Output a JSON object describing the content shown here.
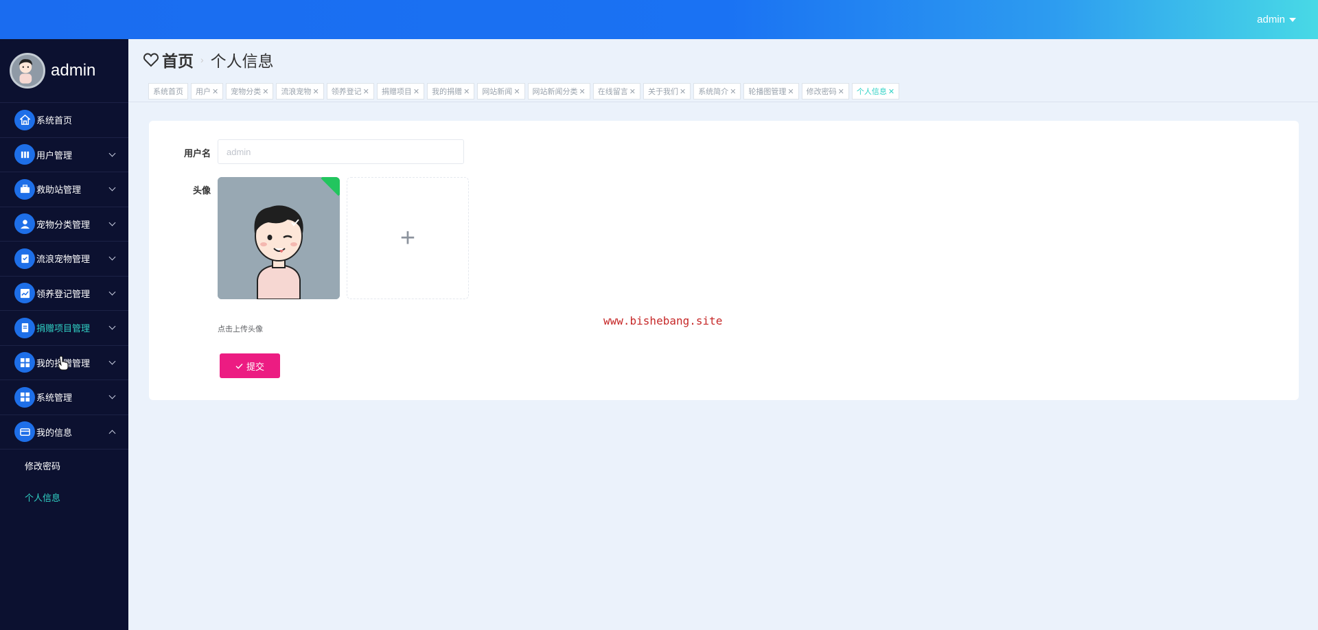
{
  "topbar": {
    "user_label": "admin"
  },
  "sidebar": {
    "profile_name": "admin",
    "items": [
      {
        "label": "系统首页",
        "icon": "home-icon"
      },
      {
        "label": "用户管理",
        "icon": "users-icon"
      },
      {
        "label": "救助站管理",
        "icon": "briefcase-icon"
      },
      {
        "label": "宠物分类管理",
        "icon": "person-icon"
      },
      {
        "label": "流浪宠物管理",
        "icon": "clipboard-icon"
      },
      {
        "label": "领养登记管理",
        "icon": "chart-icon"
      },
      {
        "label": "捐赠项目管理",
        "icon": "document-icon"
      },
      {
        "label": "我的捐赠管理",
        "icon": "grid-icon"
      },
      {
        "label": "系统管理",
        "icon": "grid-icon"
      },
      {
        "label": "我的信息",
        "icon": "card-icon"
      }
    ],
    "sub_items": [
      {
        "label": "修改密码"
      },
      {
        "label": "个人信息"
      }
    ]
  },
  "breadcrumb": {
    "home": "首页",
    "current": "个人信息"
  },
  "tags": [
    {
      "label": "系统首页",
      "closable": false
    },
    {
      "label": "用户",
      "closable": true
    },
    {
      "label": "宠物分类",
      "closable": true
    },
    {
      "label": "流浪宠物",
      "closable": true
    },
    {
      "label": "领养登记",
      "closable": true
    },
    {
      "label": "捐赠项目",
      "closable": true
    },
    {
      "label": "我的捐赠",
      "closable": true
    },
    {
      "label": "网站新闻",
      "closable": true
    },
    {
      "label": "网站新闻分类",
      "closable": true
    },
    {
      "label": "在线留言",
      "closable": true
    },
    {
      "label": "关于我们",
      "closable": true
    },
    {
      "label": "系统简介",
      "closable": true
    },
    {
      "label": "轮播图管理",
      "closable": true
    },
    {
      "label": "修改密码",
      "closable": true
    },
    {
      "label": "个人信息",
      "closable": true
    }
  ],
  "form": {
    "username_label": "用户名",
    "username_value": "admin",
    "avatar_label": "头像",
    "upload_hint": "点击上传头像",
    "submit_label": "提交",
    "plus": "+"
  },
  "watermark": "www.bishebang.site",
  "colors": {
    "primary": "#1e6fe8",
    "accent": "#31d2c6",
    "submit": "#ec1c82",
    "sidebar_bg": "#0c1130"
  }
}
